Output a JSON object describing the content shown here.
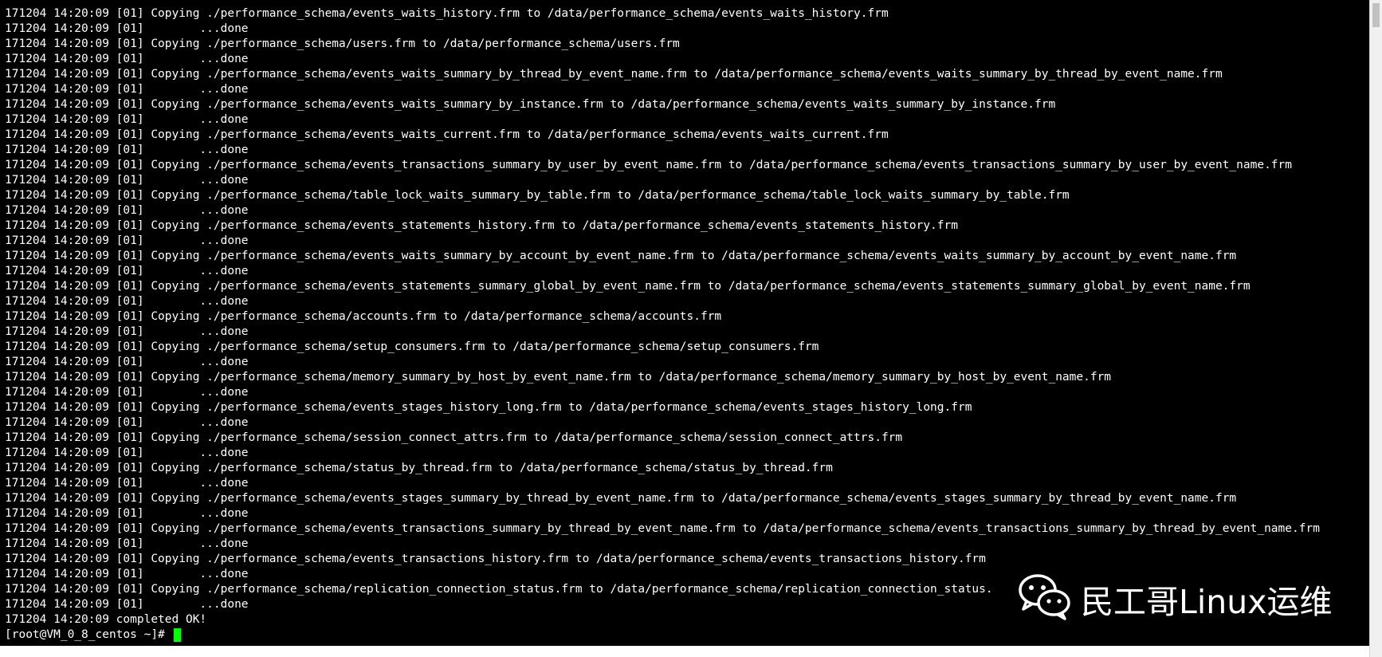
{
  "terminal": {
    "background": "#000000",
    "foreground": "#ffffff",
    "cursor_color": "#00ff00",
    "lines": [
      "171204 14:20:09 [01] Copying ./performance_schema/events_waits_history.frm to /data/performance_schema/events_waits_history.frm",
      "171204 14:20:09 [01]        ...done",
      "171204 14:20:09 [01] Copying ./performance_schema/users.frm to /data/performance_schema/users.frm",
      "171204 14:20:09 [01]        ...done",
      "171204 14:20:09 [01] Copying ./performance_schema/events_waits_summary_by_thread_by_event_name.frm to /data/performance_schema/events_waits_summary_by_thread_by_event_name.frm",
      "171204 14:20:09 [01]        ...done",
      "171204 14:20:09 [01] Copying ./performance_schema/events_waits_summary_by_instance.frm to /data/performance_schema/events_waits_summary_by_instance.frm",
      "171204 14:20:09 [01]        ...done",
      "171204 14:20:09 [01] Copying ./performance_schema/events_waits_current.frm to /data/performance_schema/events_waits_current.frm",
      "171204 14:20:09 [01]        ...done",
      "171204 14:20:09 [01] Copying ./performance_schema/events_transactions_summary_by_user_by_event_name.frm to /data/performance_schema/events_transactions_summary_by_user_by_event_name.frm",
      "171204 14:20:09 [01]        ...done",
      "171204 14:20:09 [01] Copying ./performance_schema/table_lock_waits_summary_by_table.frm to /data/performance_schema/table_lock_waits_summary_by_table.frm",
      "171204 14:20:09 [01]        ...done",
      "171204 14:20:09 [01] Copying ./performance_schema/events_statements_history.frm to /data/performance_schema/events_statements_history.frm",
      "171204 14:20:09 [01]        ...done",
      "171204 14:20:09 [01] Copying ./performance_schema/events_waits_summary_by_account_by_event_name.frm to /data/performance_schema/events_waits_summary_by_account_by_event_name.frm",
      "171204 14:20:09 [01]        ...done",
      "171204 14:20:09 [01] Copying ./performance_schema/events_statements_summary_global_by_event_name.frm to /data/performance_schema/events_statements_summary_global_by_event_name.frm",
      "171204 14:20:09 [01]        ...done",
      "171204 14:20:09 [01] Copying ./performance_schema/accounts.frm to /data/performance_schema/accounts.frm",
      "171204 14:20:09 [01]        ...done",
      "171204 14:20:09 [01] Copying ./performance_schema/setup_consumers.frm to /data/performance_schema/setup_consumers.frm",
      "171204 14:20:09 [01]        ...done",
      "171204 14:20:09 [01] Copying ./performance_schema/memory_summary_by_host_by_event_name.frm to /data/performance_schema/memory_summary_by_host_by_event_name.frm",
      "171204 14:20:09 [01]        ...done",
      "171204 14:20:09 [01] Copying ./performance_schema/events_stages_history_long.frm to /data/performance_schema/events_stages_history_long.frm",
      "171204 14:20:09 [01]        ...done",
      "171204 14:20:09 [01] Copying ./performance_schema/session_connect_attrs.frm to /data/performance_schema/session_connect_attrs.frm",
      "171204 14:20:09 [01]        ...done",
      "171204 14:20:09 [01] Copying ./performance_schema/status_by_thread.frm to /data/performance_schema/status_by_thread.frm",
      "171204 14:20:09 [01]        ...done",
      "171204 14:20:09 [01] Copying ./performance_schema/events_stages_summary_by_thread_by_event_name.frm to /data/performance_schema/events_stages_summary_by_thread_by_event_name.frm",
      "171204 14:20:09 [01]        ...done",
      "171204 14:20:09 [01] Copying ./performance_schema/events_transactions_summary_by_thread_by_event_name.frm to /data/performance_schema/events_transactions_summary_by_thread_by_event_name.frm",
      "171204 14:20:09 [01]        ...done",
      "171204 14:20:09 [01] Copying ./performance_schema/events_transactions_history.frm to /data/performance_schema/events_transactions_history.frm",
      "171204 14:20:09 [01]        ...done",
      "171204 14:20:09 [01] Copying ./performance_schema/replication_connection_status.frm to /data/performance_schema/replication_connection_status.",
      "171204 14:20:09 [01]        ...done",
      "171204 14:20:09 completed OK!"
    ],
    "prompt": "[root@VM_0_8_centos ~]# "
  },
  "watermark": {
    "icon": "wechat-icon",
    "text": "民工哥Linux运维"
  }
}
